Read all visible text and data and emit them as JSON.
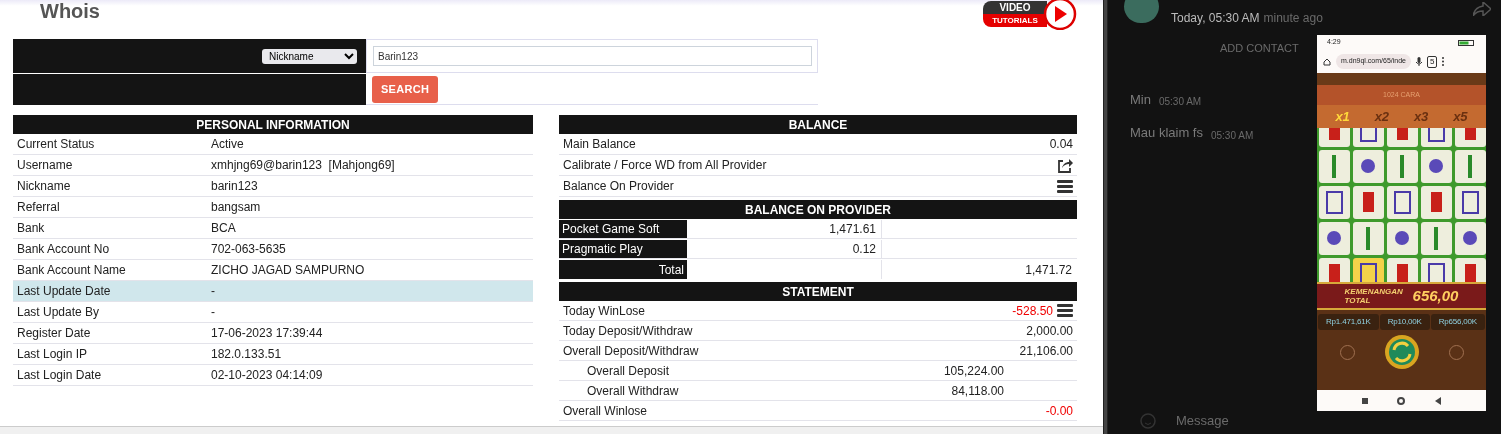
{
  "page": {
    "title": "Whois",
    "video_badge": {
      "top": "VIDEO",
      "bottom": "TUTORIALS"
    }
  },
  "search": {
    "field": "Nickname",
    "value": "Barin123",
    "button": "SEARCH"
  },
  "personal_information": {
    "title": "PERSONAL INFORMATION",
    "rows": [
      {
        "label": "Current Status",
        "value": "Active",
        "highlighted": false
      },
      {
        "label": "Username",
        "value": "xmhjng69@barin123  [Mahjong69]",
        "highlighted": false
      },
      {
        "label": "Nickname",
        "value": "barin123",
        "highlighted": false
      },
      {
        "label": "Referral",
        "value": "bangsam",
        "highlighted": false
      },
      {
        "label": "Bank",
        "value": "BCA",
        "highlighted": false
      },
      {
        "label": "Bank Account No",
        "value": "702-063-5635",
        "highlighted": false
      },
      {
        "label": "Bank Account Name",
        "value": "ZICHO JAGAD SAMPURNO",
        "highlighted": false
      },
      {
        "label": "Last Update Date",
        "value": "-",
        "highlighted": true
      },
      {
        "label": "Last Update By",
        "value": "-",
        "highlighted": false
      },
      {
        "label": "Register Date",
        "value": "17-06-2023 17:39:44",
        "highlighted": false
      },
      {
        "label": "Last Login IP",
        "value": "182.0.133.51",
        "highlighted": false
      },
      {
        "label": "Last Login Date",
        "value": "02-10-2023 04:14:09",
        "highlighted": false
      }
    ]
  },
  "balance": {
    "title": "BALANCE",
    "rows": [
      {
        "kind": "value",
        "label": "Main Balance",
        "value": "0.04"
      },
      {
        "kind": "action",
        "label": "Calibrate / Force WD from All Provider"
      },
      {
        "kind": "list",
        "label": "Balance On Provider"
      }
    ]
  },
  "balance_on_provider": {
    "title": "BALANCE ON PROVIDER",
    "rows": [
      {
        "provider": "Pocket Game Soft",
        "amount": "1,471.61"
      },
      {
        "provider": "Pragmatic Play",
        "amount": "0.12"
      }
    ],
    "total": {
      "label": "Total",
      "amount": "1,471.72"
    }
  },
  "statement": {
    "title": "STATEMENT",
    "rows": [
      {
        "kind": "main",
        "label": "Today WinLose",
        "value": "-528.50",
        "negative": true,
        "list_icon": true
      },
      {
        "kind": "main",
        "label": "Today Deposit/Withdraw",
        "value": "2,000.00",
        "negative": false,
        "list_icon": false
      },
      {
        "kind": "main",
        "label": "Overall Deposit/Withdraw",
        "value": "21,106.00",
        "negative": false,
        "list_icon": false
      },
      {
        "kind": "sub",
        "label": "Overall Deposit",
        "value": "105,224.00",
        "negative": false,
        "list_icon": false
      },
      {
        "kind": "sub",
        "label": "Overall Withdraw",
        "value": "84,118.00",
        "negative": false,
        "list_icon": false
      },
      {
        "kind": "main",
        "label": "Overall Winlose",
        "value": "-0.00",
        "negative": true,
        "list_icon": false
      }
    ]
  },
  "chat": {
    "time": "Today, 05:30 AM",
    "relative": "minute ago",
    "add_contact": "ADD CONTACT",
    "messages": [
      {
        "text": "Min",
        "time": "05:30 AM"
      },
      {
        "text": "Mau klaim fs",
        "time": "05:30 AM"
      }
    ],
    "composer": {
      "placeholder": "Message"
    },
    "phone": {
      "status_time": "4:29",
      "url": "m.dn9ql.com/65/inde",
      "tab_count": "5",
      "game": {
        "ways": "1024 CARA",
        "multipliers": [
          {
            "label": "x1",
            "selected": true
          },
          {
            "label": "x2",
            "selected": false
          },
          {
            "label": "x3",
            "selected": false
          },
          {
            "label": "x5",
            "selected": false
          }
        ],
        "win_label": "KEMENANGAN TOTAL",
        "win_amount": "656,00",
        "stats": [
          "Rp1.471,61K",
          "Rp10,00K",
          "Rp656,00K"
        ]
      }
    }
  }
}
